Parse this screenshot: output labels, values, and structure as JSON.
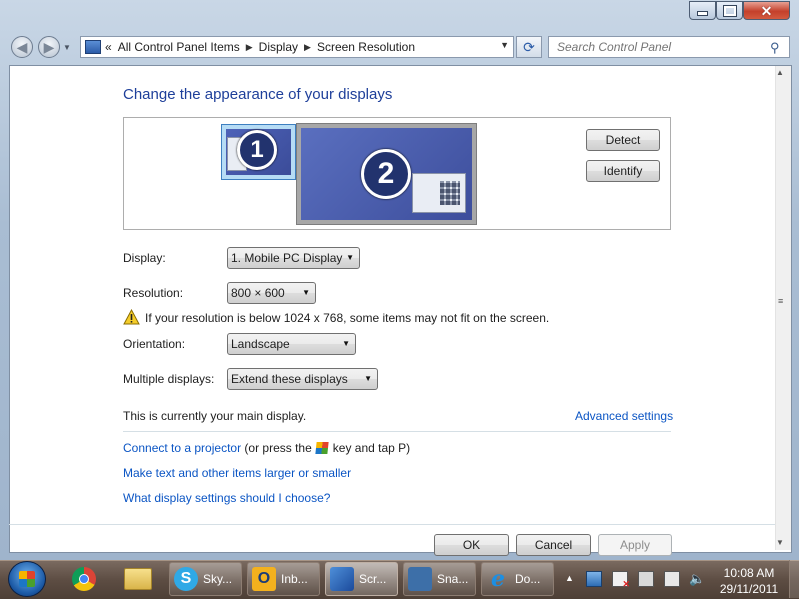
{
  "window": {
    "caption_buttons": {
      "minimize": "—",
      "maximize": "□",
      "close": "✕"
    }
  },
  "address_bar": {
    "overflow": "«",
    "crumbs": [
      "All Control Panel Items",
      "Display",
      "Screen Resolution"
    ],
    "separator": "▶",
    "dropdown": "▼"
  },
  "search": {
    "placeholder": "Search Control Panel"
  },
  "page": {
    "title": "Change the appearance of your displays",
    "monitor1_number": "1",
    "monitor2_number": "2",
    "detect_label": "Detect",
    "identify_label": "Identify",
    "display_label": "Display:",
    "display_value": "1. Mobile PC Display",
    "resolution_label": "Resolution:",
    "resolution_value": "800 × 600",
    "warning_text": "If your resolution is below 1024 x 768, some items may not fit on the screen.",
    "orientation_label": "Orientation:",
    "orientation_value": "Landscape",
    "multiple_label": "Multiple displays:",
    "multiple_value": "Extend these displays",
    "main_display_text": "This is currently your main display.",
    "advanced_link": "Advanced settings",
    "projector_link": "Connect to a projector",
    "projector_suffix_1": "(or press the",
    "projector_suffix_2": "key and tap P)",
    "text_size_link": "Make text and other items larger or smaller",
    "help_link": "What display settings should I choose?",
    "ok_label": "OK",
    "cancel_label": "Cancel",
    "apply_label": "Apply"
  },
  "taskbar": {
    "tasks": [
      {
        "label": "Sky..."
      },
      {
        "label": "Inb..."
      },
      {
        "label": "Scr..."
      },
      {
        "label": "Sna..."
      },
      {
        "label": "Do..."
      }
    ],
    "clock_time": "10:08 AM",
    "clock_date": "29/11/2011"
  },
  "colors": {
    "link": "#0b55c4",
    "heading": "#1e3f9a",
    "monitor_blue": "#3d4e9c"
  }
}
